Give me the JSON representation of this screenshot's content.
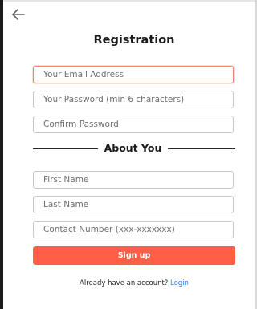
{
  "header": {
    "back_icon": "arrow-left-icon",
    "title": "Registration"
  },
  "form": {
    "email": {
      "placeholder": "Your Email Address",
      "value": ""
    },
    "password": {
      "placeholder": "Your Password (min 6 characters)",
      "value": ""
    },
    "confirm_password": {
      "placeholder": "Confirm Password",
      "value": ""
    },
    "section_title": "About You",
    "first_name": {
      "placeholder": "First Name",
      "value": ""
    },
    "last_name": {
      "placeholder": "Last Name",
      "value": ""
    },
    "contact_number": {
      "placeholder": "Contact Number (xxx-xxxxxxx)",
      "value": ""
    },
    "submit_label": "Sign up"
  },
  "footer": {
    "prompt": "Already have an account?",
    "login_label": "Login"
  },
  "colors": {
    "accent": "#ff5f47",
    "focus_border": "#f4806f",
    "link": "#2f7fd6"
  }
}
